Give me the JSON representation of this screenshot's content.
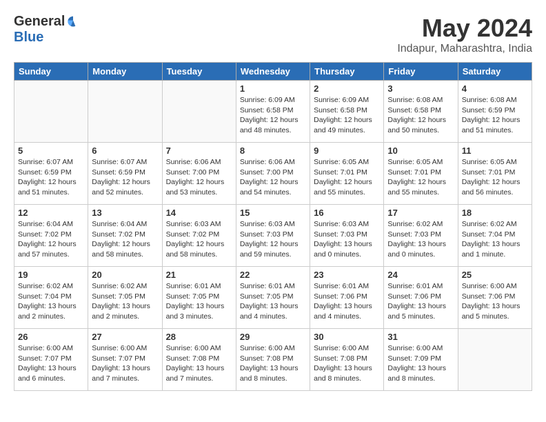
{
  "logo": {
    "general": "General",
    "blue": "Blue"
  },
  "title": "May 2024",
  "location": "Indapur, Maharashtra, India",
  "days_header": [
    "Sunday",
    "Monday",
    "Tuesday",
    "Wednesday",
    "Thursday",
    "Friday",
    "Saturday"
  ],
  "weeks": [
    [
      {
        "day": "",
        "info": ""
      },
      {
        "day": "",
        "info": ""
      },
      {
        "day": "",
        "info": ""
      },
      {
        "day": "1",
        "info": "Sunrise: 6:09 AM\nSunset: 6:58 PM\nDaylight: 12 hours\nand 48 minutes."
      },
      {
        "day": "2",
        "info": "Sunrise: 6:09 AM\nSunset: 6:58 PM\nDaylight: 12 hours\nand 49 minutes."
      },
      {
        "day": "3",
        "info": "Sunrise: 6:08 AM\nSunset: 6:58 PM\nDaylight: 12 hours\nand 50 minutes."
      },
      {
        "day": "4",
        "info": "Sunrise: 6:08 AM\nSunset: 6:59 PM\nDaylight: 12 hours\nand 51 minutes."
      }
    ],
    [
      {
        "day": "5",
        "info": "Sunrise: 6:07 AM\nSunset: 6:59 PM\nDaylight: 12 hours\nand 51 minutes."
      },
      {
        "day": "6",
        "info": "Sunrise: 6:07 AM\nSunset: 6:59 PM\nDaylight: 12 hours\nand 52 minutes."
      },
      {
        "day": "7",
        "info": "Sunrise: 6:06 AM\nSunset: 7:00 PM\nDaylight: 12 hours\nand 53 minutes."
      },
      {
        "day": "8",
        "info": "Sunrise: 6:06 AM\nSunset: 7:00 PM\nDaylight: 12 hours\nand 54 minutes."
      },
      {
        "day": "9",
        "info": "Sunrise: 6:05 AM\nSunset: 7:01 PM\nDaylight: 12 hours\nand 55 minutes."
      },
      {
        "day": "10",
        "info": "Sunrise: 6:05 AM\nSunset: 7:01 PM\nDaylight: 12 hours\nand 55 minutes."
      },
      {
        "day": "11",
        "info": "Sunrise: 6:05 AM\nSunset: 7:01 PM\nDaylight: 12 hours\nand 56 minutes."
      }
    ],
    [
      {
        "day": "12",
        "info": "Sunrise: 6:04 AM\nSunset: 7:02 PM\nDaylight: 12 hours\nand 57 minutes."
      },
      {
        "day": "13",
        "info": "Sunrise: 6:04 AM\nSunset: 7:02 PM\nDaylight: 12 hours\nand 58 minutes."
      },
      {
        "day": "14",
        "info": "Sunrise: 6:03 AM\nSunset: 7:02 PM\nDaylight: 12 hours\nand 58 minutes."
      },
      {
        "day": "15",
        "info": "Sunrise: 6:03 AM\nSunset: 7:03 PM\nDaylight: 12 hours\nand 59 minutes."
      },
      {
        "day": "16",
        "info": "Sunrise: 6:03 AM\nSunset: 7:03 PM\nDaylight: 13 hours\nand 0 minutes."
      },
      {
        "day": "17",
        "info": "Sunrise: 6:02 AM\nSunset: 7:03 PM\nDaylight: 13 hours\nand 0 minutes."
      },
      {
        "day": "18",
        "info": "Sunrise: 6:02 AM\nSunset: 7:04 PM\nDaylight: 13 hours\nand 1 minute."
      }
    ],
    [
      {
        "day": "19",
        "info": "Sunrise: 6:02 AM\nSunset: 7:04 PM\nDaylight: 13 hours\nand 2 minutes."
      },
      {
        "day": "20",
        "info": "Sunrise: 6:02 AM\nSunset: 7:05 PM\nDaylight: 13 hours\nand 2 minutes."
      },
      {
        "day": "21",
        "info": "Sunrise: 6:01 AM\nSunset: 7:05 PM\nDaylight: 13 hours\nand 3 minutes."
      },
      {
        "day": "22",
        "info": "Sunrise: 6:01 AM\nSunset: 7:05 PM\nDaylight: 13 hours\nand 4 minutes."
      },
      {
        "day": "23",
        "info": "Sunrise: 6:01 AM\nSunset: 7:06 PM\nDaylight: 13 hours\nand 4 minutes."
      },
      {
        "day": "24",
        "info": "Sunrise: 6:01 AM\nSunset: 7:06 PM\nDaylight: 13 hours\nand 5 minutes."
      },
      {
        "day": "25",
        "info": "Sunrise: 6:00 AM\nSunset: 7:06 PM\nDaylight: 13 hours\nand 5 minutes."
      }
    ],
    [
      {
        "day": "26",
        "info": "Sunrise: 6:00 AM\nSunset: 7:07 PM\nDaylight: 13 hours\nand 6 minutes."
      },
      {
        "day": "27",
        "info": "Sunrise: 6:00 AM\nSunset: 7:07 PM\nDaylight: 13 hours\nand 7 minutes."
      },
      {
        "day": "28",
        "info": "Sunrise: 6:00 AM\nSunset: 7:08 PM\nDaylight: 13 hours\nand 7 minutes."
      },
      {
        "day": "29",
        "info": "Sunrise: 6:00 AM\nSunset: 7:08 PM\nDaylight: 13 hours\nand 8 minutes."
      },
      {
        "day": "30",
        "info": "Sunrise: 6:00 AM\nSunset: 7:08 PM\nDaylight: 13 hours\nand 8 minutes."
      },
      {
        "day": "31",
        "info": "Sunrise: 6:00 AM\nSunset: 7:09 PM\nDaylight: 13 hours\nand 8 minutes."
      },
      {
        "day": "",
        "info": ""
      }
    ]
  ]
}
